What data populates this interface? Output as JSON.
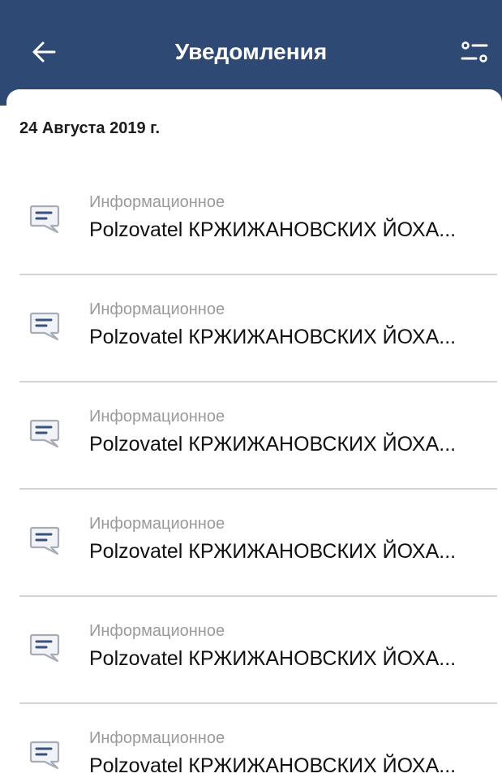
{
  "header": {
    "title": "Уведомления",
    "back_icon": "arrow-left-icon",
    "filter_icon": "filter-sliders-icon",
    "background_color": "#2e4a74"
  },
  "date_group": {
    "label": "24 Августа 2019 г."
  },
  "notifications": [
    {
      "icon": "message-icon",
      "type": "Информационное",
      "text": "Polzovatel КРЖИЖАНОВСКИХ ЙОХА..."
    },
    {
      "icon": "message-icon",
      "type": "Информационное",
      "text": "Polzovatel КРЖИЖАНОВСКИХ ЙОХА..."
    },
    {
      "icon": "message-icon",
      "type": "Информационное",
      "text": "Polzovatel КРЖИЖАНОВСКИХ ЙОХА..."
    },
    {
      "icon": "message-icon",
      "type": "Информационное",
      "text": "Polzovatel КРЖИЖАНОВСКИХ ЙОХА..."
    },
    {
      "icon": "message-icon",
      "type": "Информационное",
      "text": "Polzovatel КРЖИЖАНОВСКИХ ЙОХА..."
    },
    {
      "icon": "message-icon",
      "type": "Информационное",
      "text": "Polzovatel КРЖИЖАНОВСКИХ ЙОХА..."
    }
  ]
}
